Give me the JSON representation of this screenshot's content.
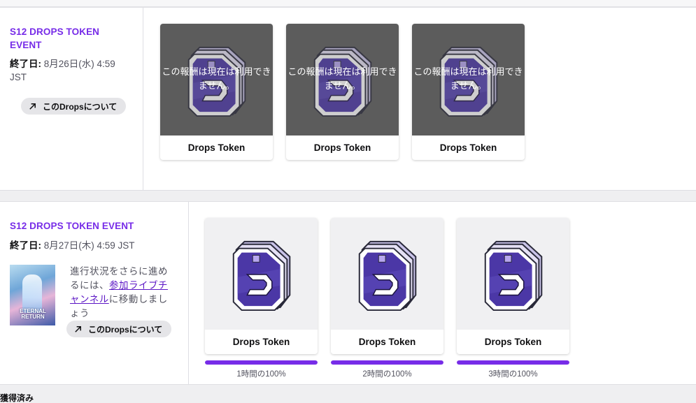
{
  "campaigns": [
    {
      "title": "S12 DROPS TOKEN EVENT",
      "end_label": "終了日:",
      "end_value": "8月26日(水) 4:59 JST",
      "about_button": "このDropsについて",
      "rewards": [
        {
          "name": "Drops Token",
          "status": "この報酬は現在は利用できません。"
        },
        {
          "name": "Drops Token",
          "status": "この報酬は現在は利用できません。"
        },
        {
          "name": "Drops Token",
          "status": "この報酬は現在は利用できません。"
        }
      ]
    },
    {
      "title": "S12 DROPS TOKEN EVENT",
      "end_label": "終了日:",
      "end_value": "8月27日(木) 4:59 JST",
      "about_button": "このDropsについて",
      "game_cover_text": "ETERNAL RETURN",
      "note_before": "進行状況をさらに進めるには、",
      "note_link": "参加ライブチャンネル",
      "note_after": "に移動しましょう",
      "rewards": [
        {
          "name": "Drops Token",
          "progress_text": "1時間の100%",
          "progress": 1.0
        },
        {
          "name": "Drops Token",
          "progress_text": "2時間の100%",
          "progress": 1.0
        },
        {
          "name": "Drops Token",
          "progress_text": "3時間の100%",
          "progress": 1.0
        }
      ]
    }
  ],
  "next_section_label": "獲得済み",
  "colors": {
    "accent": "#772ce8",
    "link": "#5c16c5",
    "unavailable_overlay": "#5c5c5c"
  },
  "icons": {
    "about": "arrow-up-right-icon",
    "reward": "drops-token-icon"
  }
}
